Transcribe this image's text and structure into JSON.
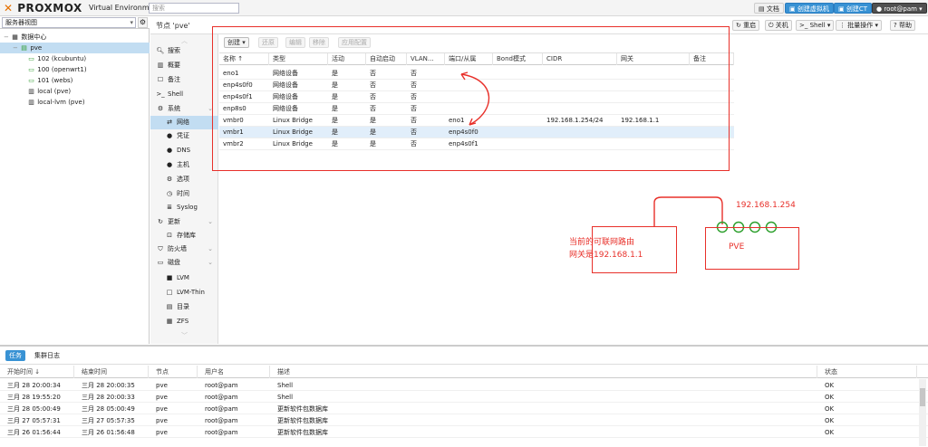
{
  "header": {
    "logo_text": "PROXMOX",
    "version": "Virtual Environment 7.4-17",
    "search_placeholder": "搜索",
    "docs": "文档",
    "create_vm": "创建虚拟机",
    "create_ct": "创建CT",
    "user": "root@pam"
  },
  "tree": {
    "view_label": "服务器视图",
    "items": [
      {
        "label": "数据中心",
        "icon": "datacenter-icon"
      },
      {
        "label": "pve",
        "icon": "server-icon"
      },
      {
        "label": "102 (kcubuntu)",
        "icon": "vm-icon"
      },
      {
        "label": "100 (openwrt1)",
        "icon": "vm-icon"
      },
      {
        "label": "101 (webs)",
        "icon": "vm-icon"
      },
      {
        "label": "local (pve)",
        "icon": "storage-icon"
      },
      {
        "label": "local-lvm (pve)",
        "icon": "storage-icon"
      }
    ]
  },
  "node": {
    "title": "节点 'pve'",
    "buttons": {
      "reboot": "重启",
      "shutdown": "关机",
      "shell": "Shell",
      "bulk": "批量操作",
      "help": "帮助"
    }
  },
  "menu": [
    {
      "label": "搜索",
      "icon": "search-icon"
    },
    {
      "label": "概要",
      "icon": "summary-icon"
    },
    {
      "label": "备注",
      "icon": "notes-icon"
    },
    {
      "label": "Shell",
      "icon": "terminal-icon"
    },
    {
      "label": "系统",
      "icon": "gears-icon",
      "expandable": true
    },
    {
      "label": "网络",
      "icon": "network-icon"
    },
    {
      "label": "凭证",
      "icon": "certificate-icon"
    },
    {
      "label": "DNS",
      "icon": "globe-icon"
    },
    {
      "label": "主机",
      "icon": "globe-icon"
    },
    {
      "label": "选项",
      "icon": "gear-icon"
    },
    {
      "label": "时间",
      "icon": "clock-icon"
    },
    {
      "label": "Syslog",
      "icon": "list-icon"
    },
    {
      "label": "更新",
      "icon": "refresh-icon",
      "expandable": true
    },
    {
      "label": "存储库",
      "icon": "repository-icon"
    },
    {
      "label": "防火墙",
      "icon": "shield-icon",
      "expandable": true
    },
    {
      "label": "磁盘",
      "icon": "disk-icon",
      "expandable": true
    },
    {
      "label": "LVM",
      "icon": "lvm-icon"
    },
    {
      "label": "LVM-Thin",
      "icon": "lvm-thin-icon"
    },
    {
      "label": "目录",
      "icon": "folder-icon"
    },
    {
      "label": "ZFS",
      "icon": "zfs-icon"
    }
  ],
  "network": {
    "toolbar": {
      "create": "创建",
      "revert": "还原",
      "edit": "编辑",
      "remove": "移除",
      "apply": "应用配置"
    },
    "columns": [
      "名称 ↑",
      "类型",
      "活动",
      "自动启动",
      "VLAN...",
      "端口/从属",
      "Bond模式",
      "CIDR",
      "网关",
      "备注"
    ],
    "rows": [
      [
        "eno1",
        "网络设备",
        "是",
        "否",
        "否",
        "",
        "",
        "",
        "",
        ""
      ],
      [
        "enp4s0f0",
        "网络设备",
        "是",
        "否",
        "否",
        "",
        "",
        "",
        "",
        ""
      ],
      [
        "enp4s0f1",
        "网络设备",
        "是",
        "否",
        "否",
        "",
        "",
        "",
        "",
        ""
      ],
      [
        "enp8s0",
        "网络设备",
        "是",
        "否",
        "否",
        "",
        "",
        "",
        "",
        ""
      ],
      [
        "vmbr0",
        "Linux Bridge",
        "是",
        "是",
        "否",
        "eno1",
        "",
        "192.168.1.254/24",
        "192.168.1.1",
        ""
      ],
      [
        "vmbr1",
        "Linux Bridge",
        "是",
        "是",
        "否",
        "enp4s0f0",
        "",
        "",
        "",
        ""
      ],
      [
        "vmbr2",
        "Linux Bridge",
        "是",
        "是",
        "否",
        "enp4s0f1",
        "",
        "",
        "",
        ""
      ]
    ]
  },
  "annotation": {
    "ip": "192.168.1.254",
    "pve_label": "PVE",
    "gateway_note_line1": "当前的可联网路由",
    "gateway_note_line2": "网关是192.168.1.1",
    "color": "#e8302a"
  },
  "tasks": {
    "tabs": [
      "任务",
      "集群日志"
    ],
    "columns": [
      "开始时间 ↓",
      "结束时间",
      "节点",
      "用户名",
      "描述",
      "状态"
    ],
    "rows": [
      [
        "三月 28 20:00:34",
        "三月 28 20:00:35",
        "pve",
        "root@pam",
        "Shell",
        "OK"
      ],
      [
        "三月 28 19:55:20",
        "三月 28 20:00:33",
        "pve",
        "root@pam",
        "Shell",
        "OK"
      ],
      [
        "三月 28 05:00:49",
        "三月 28 05:00:49",
        "pve",
        "root@pam",
        "更新软件包数据库",
        "OK"
      ],
      [
        "三月 27 05:57:31",
        "三月 27 05:57:35",
        "pve",
        "root@pam",
        "更新软件包数据库",
        "OK"
      ],
      [
        "三月 26 01:56:44",
        "三月 26 01:56:48",
        "pve",
        "root@pam",
        "更新软件包数据库",
        "OK"
      ]
    ]
  }
}
